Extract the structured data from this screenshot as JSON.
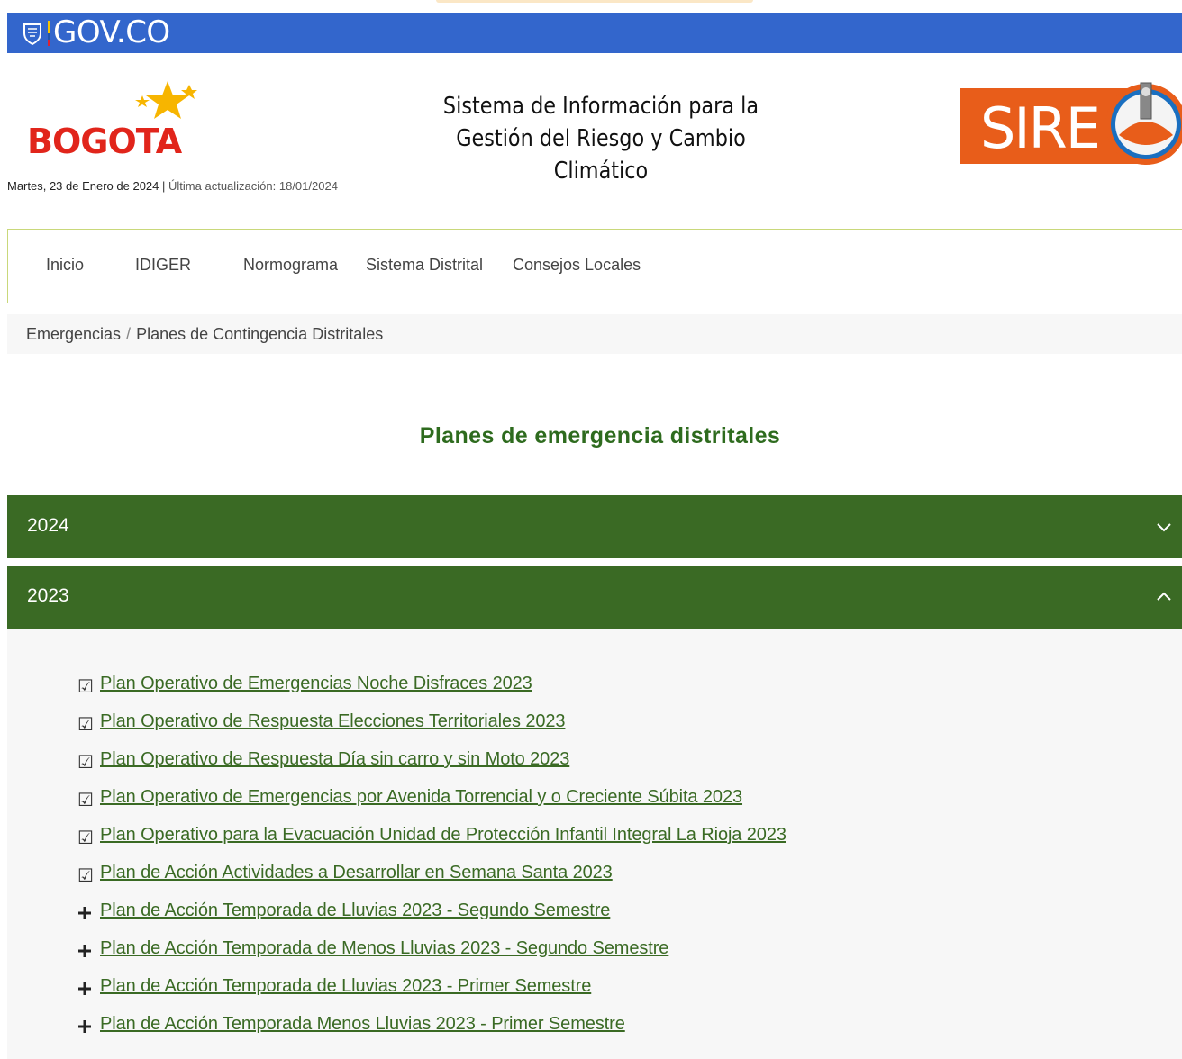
{
  "gov_bar": {
    "brand": "GOV.CO"
  },
  "header": {
    "city_logo_text": "BOGOTA",
    "title_line1": "Sistema de Información para la",
    "title_line2": "Gestión del Riesgo y Cambio Climático",
    "sire_logo_text": "SIRE",
    "date": "Martes, 23 de Enero de 2024",
    "separator": "|",
    "last_update": "Última actualización: 18/01/2024"
  },
  "nav": {
    "items": [
      {
        "label": "Inicio"
      },
      {
        "label": "IDIGER"
      },
      {
        "label": "Normograma"
      },
      {
        "label": "Sistema Distrital"
      },
      {
        "label": "Consejos Locales"
      }
    ]
  },
  "breadcrumb": {
    "parent": "Emergencias",
    "separator": "/",
    "current": "Planes de Contingencia Distritales"
  },
  "main": {
    "title": "Planes de emergencia distritales",
    "accordion": [
      {
        "label": "2024",
        "expanded": false
      },
      {
        "label": "2023",
        "expanded": true
      }
    ],
    "items_2023": [
      {
        "icon": "checkbox-icon",
        "glyph": "☑",
        "label": "Plan Operativo de Emergencias Noche Disfraces 2023"
      },
      {
        "icon": "checkbox-icon",
        "glyph": "☑",
        "label": "Plan Operativo de Respuesta Elecciones Territoriales 2023"
      },
      {
        "icon": "checkbox-icon",
        "glyph": "☑",
        "label": "Plan Operativo de Respuesta Día sin carro y sin Moto 2023"
      },
      {
        "icon": "checkbox-icon",
        "glyph": "☑",
        "label": "Plan Operativo de Emergencias por Avenida Torrencial y o Creciente Súbita 2023"
      },
      {
        "icon": "checkbox-icon",
        "glyph": "☑",
        "label": "Plan Operativo para la Evacuación Unidad de Protección Infantil Integral La Rioja 2023"
      },
      {
        "icon": "checkbox-icon",
        "glyph": "☑",
        "label": "Plan de Acción Actividades a Desarrollar en Semana Santa 2023"
      },
      {
        "icon": "plus-icon",
        "glyph": "+",
        "label": "Plan de Acción Temporada de Lluvias 2023 - Segundo Semestre"
      },
      {
        "icon": "plus-icon",
        "glyph": "+",
        "label": "Plan de Acción Temporada de Menos Lluvias 2023 - Segundo Semestre"
      },
      {
        "icon": "plus-icon",
        "glyph": "+",
        "label": "Plan de Acción Temporada de Lluvias 2023 - Primer Semestre"
      },
      {
        "icon": "plus-icon",
        "glyph": "+",
        "label": "Plan de Acción Temporada Menos Lluvias 2023 - Primer Semestre"
      }
    ]
  },
  "colors": {
    "gov_blue": "#3366cc",
    "accordion_green": "#3a6a24",
    "heading_green": "#2e6b1e",
    "bogota_red": "#e1251b",
    "star_yellow": "#f7b500",
    "sire_orange": "#e85d1a"
  }
}
